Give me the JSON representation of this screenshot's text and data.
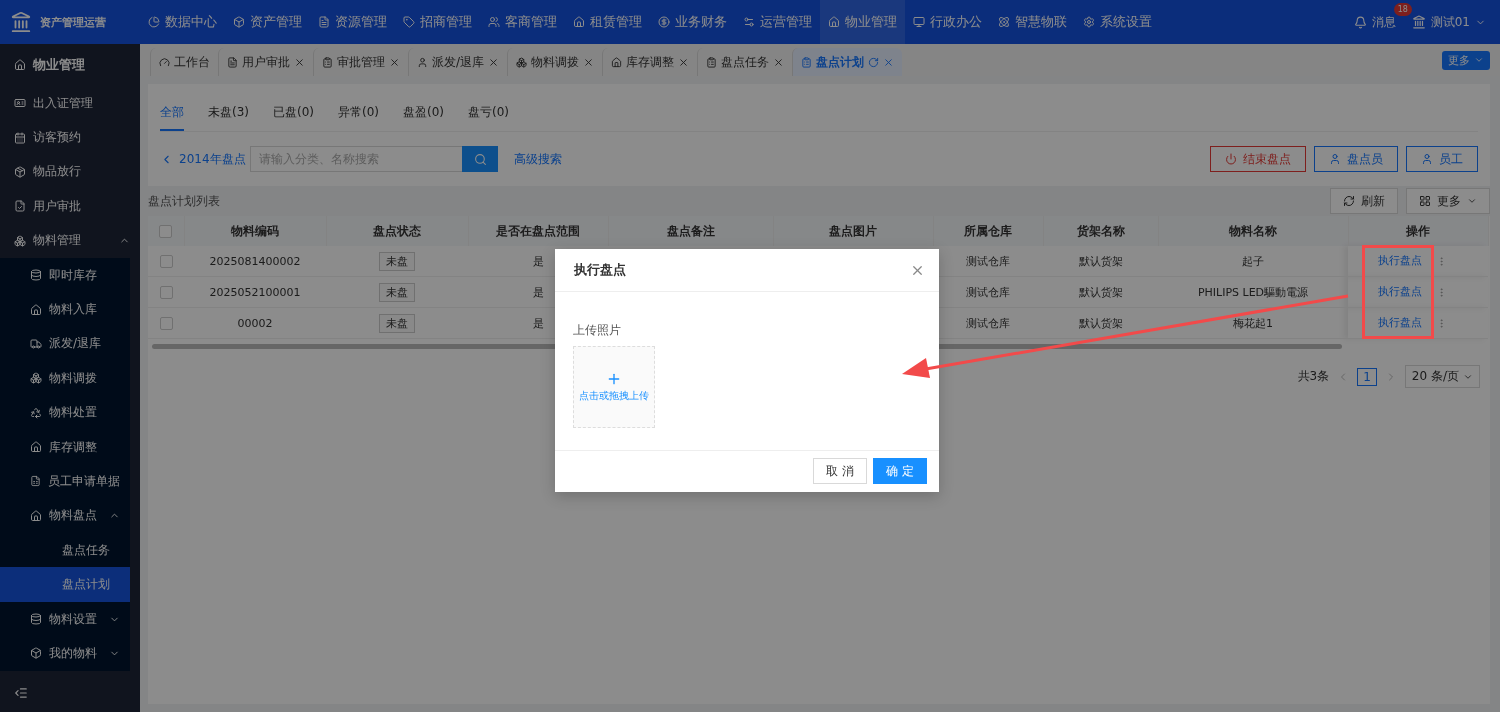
{
  "app": {
    "title": "资产管理运营"
  },
  "top_nav": [
    {
      "label": "数据中心",
      "selected": false
    },
    {
      "label": "资产管理",
      "selected": false
    },
    {
      "label": "资源管理",
      "selected": false
    },
    {
      "label": "招商管理",
      "selected": false
    },
    {
      "label": "客商管理",
      "selected": false
    },
    {
      "label": "租赁管理",
      "selected": false
    },
    {
      "label": "业务财务",
      "selected": false
    },
    {
      "label": "运营管理",
      "selected": false
    },
    {
      "label": "物业管理",
      "selected": true
    },
    {
      "label": "行政办公",
      "selected": false
    },
    {
      "label": "智慧物联",
      "selected": false
    },
    {
      "label": "系统设置",
      "selected": false
    }
  ],
  "messages": {
    "label": "消息",
    "badge": "18"
  },
  "user": {
    "name": "测试01"
  },
  "sidebar": {
    "title": "物业管理",
    "items": [
      {
        "label": "出入证管理",
        "selected": false
      },
      {
        "label": "访客预约",
        "selected": false
      },
      {
        "label": "物品放行",
        "selected": false
      },
      {
        "label": "用户审批",
        "selected": false
      },
      {
        "label": "物料管理",
        "selected": false,
        "expanded": true,
        "children": [
          {
            "label": "即时库存",
            "selected": false
          },
          {
            "label": "物料入库",
            "selected": false
          },
          {
            "label": "派发/退库",
            "selected": false
          },
          {
            "label": "物料调拨",
            "selected": false
          },
          {
            "label": "物料处置",
            "selected": false
          },
          {
            "label": "库存调整",
            "selected": false
          },
          {
            "label": "员工申请单据",
            "selected": false
          },
          {
            "label": "物料盘点",
            "selected": false,
            "expanded": true,
            "children": [
              {
                "label": "盘点任务",
                "selected": false
              },
              {
                "label": "盘点计划",
                "selected": true
              }
            ]
          },
          {
            "label": "物料设置",
            "selected": false,
            "expanded": false
          },
          {
            "label": "我的物料",
            "selected": false,
            "expanded": false
          }
        ]
      }
    ]
  },
  "tabs": [
    {
      "label": "工作台",
      "selected": false,
      "closable": false
    },
    {
      "label": "用户审批",
      "selected": false,
      "closable": true
    },
    {
      "label": "审批管理",
      "selected": false,
      "closable": true
    },
    {
      "label": "派发/退库",
      "selected": false,
      "closable": true
    },
    {
      "label": "物料调拨",
      "selected": false,
      "closable": true
    },
    {
      "label": "库存调整",
      "selected": false,
      "closable": true
    },
    {
      "label": "盘点任务",
      "selected": false,
      "closable": true
    },
    {
      "label": "盘点计划",
      "selected": true,
      "closable": true
    }
  ],
  "tabs_more": "更多",
  "filter_tabs": [
    {
      "label": "全部",
      "selected": true
    },
    {
      "label": "未盘(3)",
      "selected": false
    },
    {
      "label": "已盘(0)",
      "selected": false
    },
    {
      "label": "异常(0)",
      "selected": false
    },
    {
      "label": "盘盈(0)",
      "selected": false
    },
    {
      "label": "盘亏(0)",
      "selected": false
    }
  ],
  "back_link": "2014年盘点",
  "search": {
    "placeholder": "请输入分类、名称搜索"
  },
  "advanced_search": "高级搜索",
  "actions": [
    {
      "label": "结束盘点",
      "kind": "danger"
    },
    {
      "label": "盘点员",
      "kind": "person"
    },
    {
      "label": "员工",
      "kind": "person"
    }
  ],
  "table": {
    "title": "盘点计划列表",
    "refresh": "刷新",
    "more": "更多",
    "all_checked": false,
    "columns": [
      "物料编码",
      "盘点状态",
      "是否在盘点范围",
      "盘点备注",
      "盘点图片",
      "所属仓库",
      "货架名称",
      "物料名称",
      "操作"
    ],
    "rows": [
      {
        "checked": false,
        "code": "2025081400002",
        "status": "未盘",
        "in_range": "是",
        "warehouse": "测试仓库",
        "shelf": "默认货架",
        "material": "起子",
        "action": "执行盘点"
      },
      {
        "checked": false,
        "code": "2025052100001",
        "status": "未盘",
        "in_range": "是",
        "warehouse": "测试仓库",
        "shelf": "默认货架",
        "material": "PHILIPS LED驅動電源",
        "action": "执行盘点"
      },
      {
        "checked": false,
        "code": "00002",
        "status": "未盘",
        "in_range": "是",
        "warehouse": "测试仓库",
        "shelf": "默认货架",
        "material": "梅花起1",
        "action": "执行盘点"
      }
    ]
  },
  "pagination": {
    "total": "共3条",
    "page": "1",
    "page_size": "20 条/页"
  },
  "dialog": {
    "title": "执行盘点",
    "upload_label": "上传照片",
    "upload_hint": "点击或拖拽上传",
    "buttons": [
      {
        "label": "取 消",
        "kind": "default"
      },
      {
        "label": "确 定",
        "kind": "primary"
      }
    ]
  }
}
